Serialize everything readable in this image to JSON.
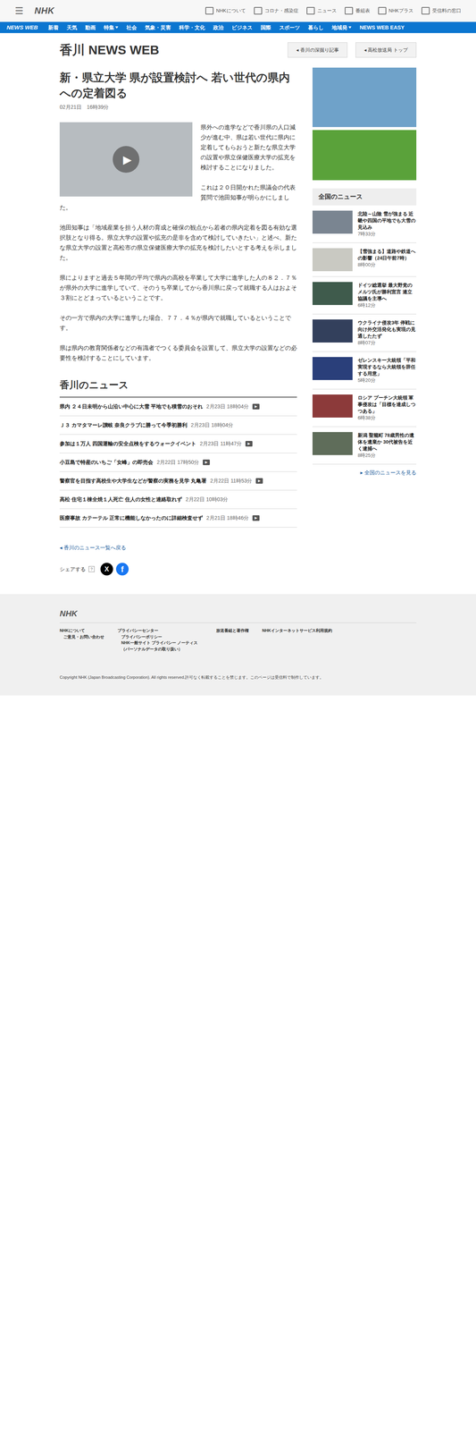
{
  "header": {
    "menu_icon": "☰",
    "logo": "NHK",
    "links": [
      "NHKについて",
      "コロナ・感染症",
      "ニュース",
      "番組表",
      "NHKプラス",
      "受信料の窓口"
    ]
  },
  "nav": {
    "logo": "NEWS WEB",
    "items": [
      {
        "label": "新着",
        "dropdown": false
      },
      {
        "label": "天気",
        "dropdown": false
      },
      {
        "label": "動画",
        "dropdown": false
      },
      {
        "label": "特集",
        "dropdown": true
      },
      {
        "label": "社会",
        "dropdown": false
      },
      {
        "label": "気象・災害",
        "dropdown": false
      },
      {
        "label": "科学・文化",
        "dropdown": false
      },
      {
        "label": "政治",
        "dropdown": false
      },
      {
        "label": "ビジネス",
        "dropdown": false
      },
      {
        "label": "国際",
        "dropdown": false
      },
      {
        "label": "スポーツ",
        "dropdown": false
      },
      {
        "label": "暮らし",
        "dropdown": false
      },
      {
        "label": "地域発",
        "dropdown": true
      },
      {
        "label": "NEWS WEB EASY",
        "dropdown": false
      }
    ]
  },
  "page": {
    "title": "香川 NEWS WEB",
    "buttons": [
      "香川の深掘り記事",
      "高松放送局 トップ"
    ],
    "button_arrow": "◂"
  },
  "article": {
    "title": "新・県立大学 県が設置検討へ 若い世代の県内への定着図る",
    "date": "02月21日　16時39分",
    "play_icon": "▶",
    "paragraphs": [
      "県外への進学などで香川県の人口減少が進む中、県は若い世代に県内に定着してもらおうと新たな県立大学の設置や県立保健医療大学の拡充を検討することになりました。",
      "これは２０日開かれた県議会の代表質問で池田知事が明らかにしました。",
      "池田知事は「地域産業を担う人材の育成と確保の観点から若者の県内定着を図る有効な選択肢となり得る。県立大学の設置や拡充の是非を含めて検討していきたい」と述べ、新たな県立大学の設置と高松市の県立保健医療大学の拡充を検討したいとする考えを示しました。",
      "県によりますと過去５年間の平均で県内の高校を卒業して大学に進学した人の８２．７％が県外の大学に進学していて、そのうち卒業してから香川県に戻って就職する人はおよそ３割にとどまっているということです。",
      "その一方で県内の大学に進学した場合、７７．４％が県内で就職しているということです。",
      "県は県内の教育関係者などの有識者でつくる委員会を設置して、県立大学の設置などの必要性を検討することにしています。"
    ]
  },
  "local_news": {
    "heading": "香川のニュース",
    "video_icon": "▶",
    "items": [
      {
        "title": "県内 ２４日未明から山沿い中心に大雪 平地でも積雪のおそれ",
        "time": "2月23日 18時04分",
        "video": true
      },
      {
        "title": "Ｊ３ カマタマーレ讃岐 奈良クラブに勝って今季初勝利",
        "time": "2月23日 18時04分",
        "video": false
      },
      {
        "title": "参加は１万人 四国運輸の安全点検をするウォークイベント",
        "time": "2月23日 11時47分",
        "video": true
      },
      {
        "title": "小豆島で特産のいちご「女峰」の即売会",
        "time": "2月22日 17時50分",
        "video": true
      },
      {
        "title": "警察官を目指す高校生や大学生などが警察の実務を見学 丸亀署",
        "time": "2月22日 11時53分",
        "video": true
      },
      {
        "title": "高松 住宅１棟全焼１人死亡 住人の女性と連絡取れず",
        "time": "2月22日 10時03分",
        "video": false
      },
      {
        "title": "医療事故 カテーテル 正常に機能しなかったのに詳細検査せず",
        "time": "2月21日 18時46分",
        "video": true
      }
    ],
    "back_link": "◂ 香川のニュース一覧へ戻る"
  },
  "share": {
    "label": "シェアする",
    "help": "?",
    "x": "X",
    "facebook": "f"
  },
  "sidebar": {
    "heading": "全国のニュース",
    "items": [
      {
        "title": "北陸～山陰 雪が強まる 近畿や四国の平地でも大雪の見込み",
        "time": "7時33分",
        "color": "#7a8591"
      },
      {
        "title": "【雪強まる】道路や鉄道への影響（24日午前7時）",
        "time": "8時00分",
        "color": "#c9c9c2"
      },
      {
        "title": "ドイツ総選挙 最大野党のメルツ氏が勝利宣言 連立協議を主導へ",
        "time": "6時12分",
        "color": "#3f5b4c"
      },
      {
        "title": "ウクライナ侵攻3年 停戦に向け外交活発化も実現の見通したたず",
        "time": "8時07分",
        "color": "#33405c"
      },
      {
        "title": "ゼレンスキー大統領「平和実現するなら大統領を辞任する用意」",
        "time": "5時20分",
        "color": "#2a3f7a"
      },
      {
        "title": "ロシア プーチン大統領 軍事侵攻は「目標を達成しつつある」",
        "time": "6時38分",
        "color": "#8c3a3a"
      },
      {
        "title": "新潟 聖籠町 78歳男性の遺体を遺棄か 30代被告を近く逮捕へ",
        "time": "8時25分",
        "color": "#5f6d5a"
      }
    ],
    "more_link": "▸ 全国のニュースを見る"
  },
  "footer": {
    "logo": "NHK",
    "columns": [
      [
        "NHKについて",
        "ご意見・お問い合わせ"
      ],
      [
        "プライバシーセンター",
        "プライバシーポリシー",
        "NHK一般サイト プライバシー ノーティス（パーソナルデータの取り扱い）"
      ],
      [
        "放送番組と著作権"
      ],
      [
        "NHKインターネットサービス利用規約"
      ]
    ],
    "copyright": "Copyright NHK (Japan Broadcasting Corporation). All rights reserved.許可なく転載することを禁じます。このページは受信料で制作しています。"
  }
}
